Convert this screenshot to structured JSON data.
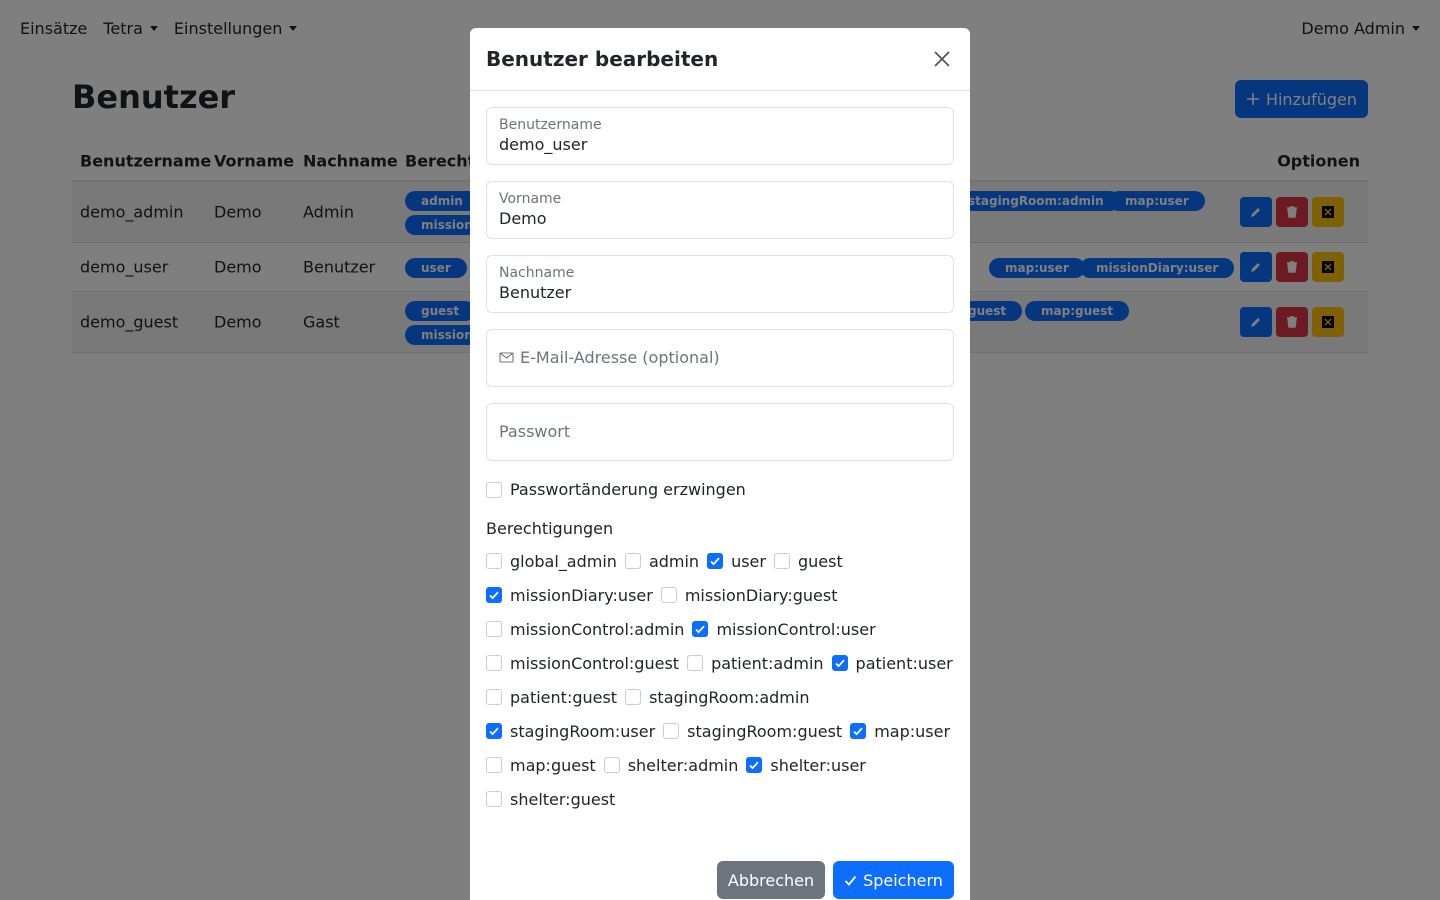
{
  "nav": {
    "missions": "Einsätze",
    "tetra": "Tetra",
    "settings": "Einstellungen",
    "user_menu": "Demo Admin"
  },
  "page": {
    "title": "Benutzer",
    "add_button": "Hinzufügen"
  },
  "table": {
    "headers": {
      "username": "Benutzername",
      "firstname": "Vorname",
      "lastname": "Nachname",
      "permissions": "Berechti",
      "options": "Optionen"
    },
    "rows": [
      {
        "username": "demo_admin",
        "firstname": "Demo",
        "lastname": "Admin",
        "badges_left": [
          "admin",
          "mission"
        ],
        "badges_right": [
          "stagingRoom:admin",
          "map:user"
        ]
      },
      {
        "username": "demo_user",
        "firstname": "Demo",
        "lastname": "Benutzer",
        "badges_left": [
          "user"
        ],
        "badges_right": [
          "map:user",
          "missionDiary:user"
        ]
      },
      {
        "username": "demo_guest",
        "firstname": "Demo",
        "lastname": "Gast",
        "badges_left": [
          "guest",
          "mission"
        ],
        "badges_right": [
          "guest",
          "map:guest"
        ]
      }
    ]
  },
  "modal": {
    "title": "Benutzer bearbeiten",
    "fields": {
      "username_label": "Benutzername",
      "username_value": "demo_user",
      "firstname_label": "Vorname",
      "firstname_value": "Demo",
      "lastname_label": "Nachname",
      "lastname_value": "Benutzer",
      "email_placeholder": "E-Mail-Adresse (optional)",
      "password_placeholder": "Passwort"
    },
    "force_password_change": "Passwortänderung erzwingen",
    "permissions_heading": "Berechtigungen",
    "permission_rows": [
      [
        {
          "label": "global_admin",
          "checked": false
        },
        {
          "label": "admin",
          "checked": false
        },
        {
          "label": "user",
          "checked": true
        },
        {
          "label": "guest",
          "checked": false
        }
      ],
      [
        {
          "label": "missionDiary:user",
          "checked": true
        },
        {
          "label": "missionDiary:guest",
          "checked": false
        }
      ],
      [
        {
          "label": "missionControl:admin",
          "checked": false
        },
        {
          "label": "missionControl:user",
          "checked": true
        }
      ],
      [
        {
          "label": "missionControl:guest",
          "checked": false
        },
        {
          "label": "patient:admin",
          "checked": false
        },
        {
          "label": "patient:user",
          "checked": true
        }
      ],
      [
        {
          "label": "patient:guest",
          "checked": false
        },
        {
          "label": "stagingRoom:admin",
          "checked": false
        }
      ],
      [
        {
          "label": "stagingRoom:user",
          "checked": true
        },
        {
          "label": "stagingRoom:guest",
          "checked": false
        },
        {
          "label": "map:user",
          "checked": true
        }
      ],
      [
        {
          "label": "map:guest",
          "checked": false
        },
        {
          "label": "shelter:admin",
          "checked": false
        },
        {
          "label": "shelter:user",
          "checked": true
        }
      ],
      [
        {
          "label": "shelter:guest",
          "checked": false
        }
      ]
    ],
    "cancel_button": "Abbrechen",
    "save_button": "Speichern"
  },
  "colors": {
    "primary": "#0d6efd",
    "danger": "#dc3545",
    "warning": "#ffc107",
    "secondary": "#6c757d"
  }
}
